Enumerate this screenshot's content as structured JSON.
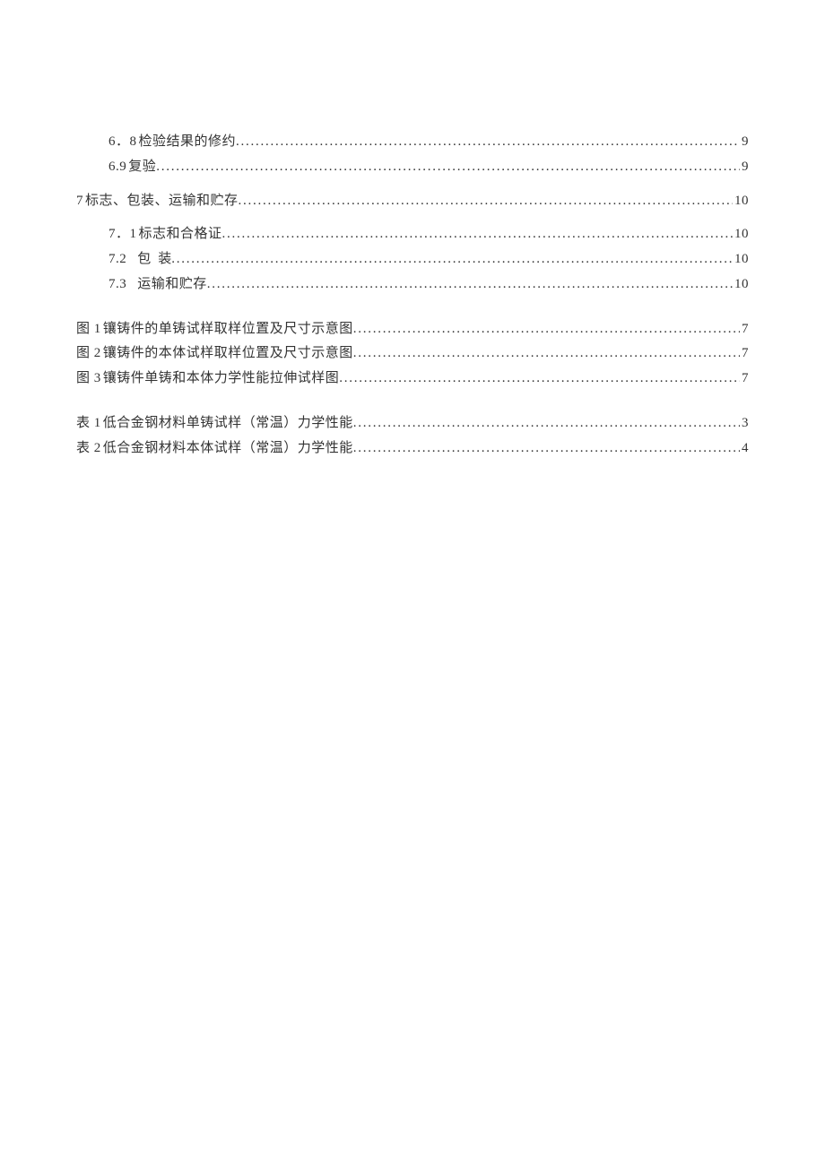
{
  "toc": {
    "sections": [
      {
        "indent": 1,
        "num": "6．8",
        "title": "检验结果的修约",
        "page": "9"
      },
      {
        "indent": 1,
        "num": "6.9",
        "title": "复验",
        "page": "9"
      },
      {
        "indent": 0,
        "num": "7",
        "title": "标志、包装、运输和贮存",
        "page": "10"
      },
      {
        "indent": 1,
        "num": "7．1",
        "title": "标志和合格证",
        "page": "10"
      },
      {
        "indent": 1,
        "num": "7.2",
        "title": "包装",
        "page": "10",
        "spaced": true
      },
      {
        "indent": 1,
        "num": "7.3",
        "title": "运输和贮存",
        "page": "10",
        "spaced_num": true
      }
    ],
    "figures": [
      {
        "label": "图 1",
        "title": "镶铸件的单铸试样取样位置及尺寸示意图",
        "page": "7"
      },
      {
        "label": "图 2",
        "title": "镶铸件的本体试样取样位置及尺寸示意图",
        "page": "7"
      },
      {
        "label": "图 3",
        "title": "镶铸件单铸和本体力学性能拉伸试样图",
        "page": "7"
      }
    ],
    "tables": [
      {
        "label": "表 1",
        "title": "低合金钢材料单铸试样（常温）力学性能",
        "page": "3"
      },
      {
        "label": "表 2",
        "title": "低合金钢材料本体试样（常温）力学性能",
        "page": "4"
      }
    ]
  }
}
